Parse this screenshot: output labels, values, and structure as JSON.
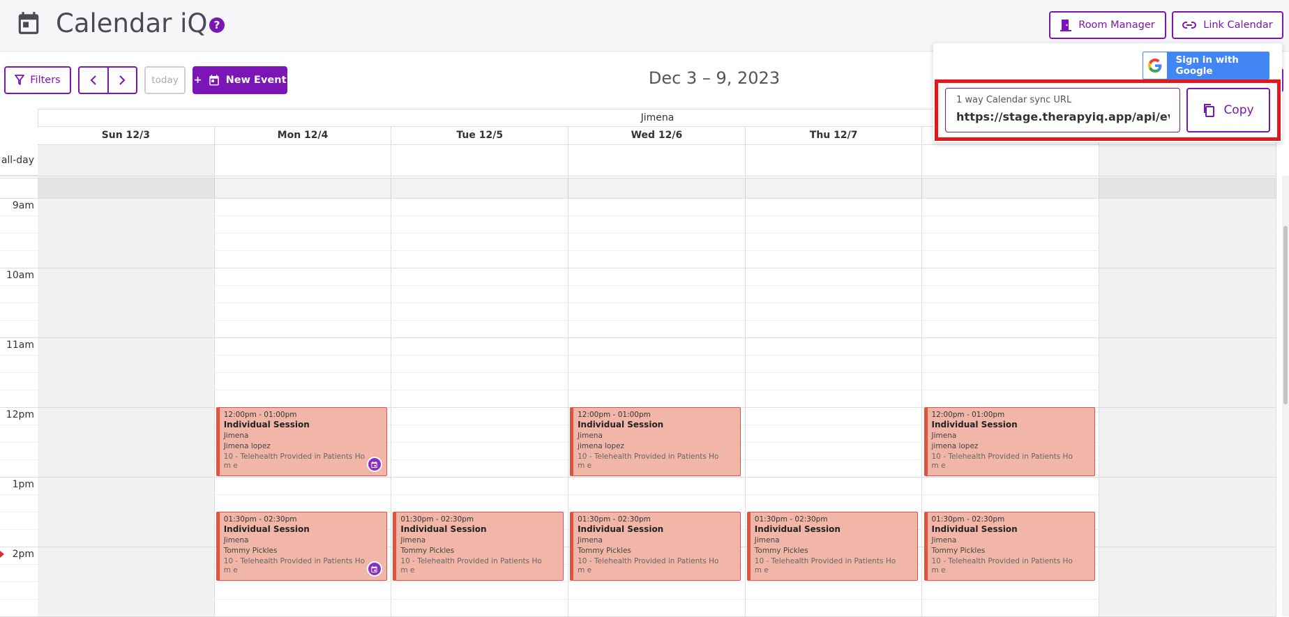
{
  "header": {
    "app_title": "Calendar iQ",
    "help_glyph": "?",
    "room_manager_label": "Room Manager",
    "link_calendar_label": "Link Calendar"
  },
  "toolbar": {
    "filters_label": "Filters",
    "prev_glyph": "‹",
    "next_glyph": "›",
    "today_label": "today",
    "new_event_label": "New Event",
    "new_event_plus": "+",
    "date_range": "Dec 3 – 9, 2023"
  },
  "calendar": {
    "resource_name": "Jimena",
    "all_day_label": "all-day",
    "days": [
      {
        "label": "Sun 12/3"
      },
      {
        "label": "Mon 12/4"
      },
      {
        "label": "Tue 12/5"
      },
      {
        "label": "Wed 12/6"
      },
      {
        "label": "Thu 12/7"
      },
      {
        "label": ""
      },
      {
        "label": ""
      }
    ],
    "time_labels": [
      "9am",
      "10am",
      "11am",
      "12pm",
      "1pm",
      "2pm"
    ],
    "events": [
      {
        "time": "12:00pm - 01:00pm",
        "title": "Individual Session",
        "therapist": "Jimena",
        "client": "Jimena lopez",
        "location": "10 - Telehealth Provided in Patients Hom e",
        "badge": true
      },
      {
        "time": "12:00pm - 01:00pm",
        "title": "Individual Session",
        "therapist": "Jimena",
        "client": "jimena lopez",
        "location": "10 - Telehealth Provided in Patients Hom e",
        "badge": false
      },
      {
        "time": "12:00pm - 01:00pm",
        "title": "Individual Session",
        "therapist": "Jimena",
        "client": "jimena lopez",
        "location": "10 - Telehealth Provided in Patients Hom e",
        "badge": false
      },
      {
        "time": "01:30pm - 02:30pm",
        "title": "Individual Session",
        "therapist": "Jimena",
        "client": "Tommy Pickles",
        "location": "10 - Telehealth Provided in Patients Hom e",
        "badge": true
      },
      {
        "time": "01:30pm - 02:30pm",
        "title": "Individual Session",
        "therapist": "Jimena",
        "client": "Tommy Pickles",
        "location": "10 - Telehealth Provided in Patients Hom e",
        "badge": false
      },
      {
        "time": "01:30pm - 02:30pm",
        "title": "Individual Session",
        "therapist": "Jimena",
        "client": "Tommy Pickles",
        "location": "10 - Telehealth Provided in Patients Hom e",
        "badge": false
      },
      {
        "time": "01:30pm - 02:30pm",
        "title": "Individual Session",
        "therapist": "Jimena",
        "client": "Tommy Pickles",
        "location": "10 - Telehealth Provided in Patients Hom e",
        "badge": false
      },
      {
        "time": "01:30pm - 02:30pm",
        "title": "Individual Session",
        "therapist": "Jimena",
        "client": "Tommy Pickles",
        "location": "10 - Telehealth Provided in Patients Hom e",
        "badge": false
      }
    ]
  },
  "link_popup": {
    "google_label": "Sign in with Google",
    "sync_label": "1 way Calendar sync URL",
    "sync_value": "https://stage.therapyiq.app/api/events/ical",
    "copy_label": "Copy"
  },
  "colors": {
    "accent": "#7b15b5",
    "event_bg": "#f2b6a9",
    "event_border": "#e0543f",
    "highlight": "#e3171e",
    "google_blue": "#4285f4"
  },
  "icons": {
    "app": "calendar-icon",
    "help": "help-circle-icon",
    "room": "door-icon",
    "link": "link-icon",
    "filter": "filter-icon",
    "copy": "copy-icon",
    "google": "google-logo-icon"
  }
}
